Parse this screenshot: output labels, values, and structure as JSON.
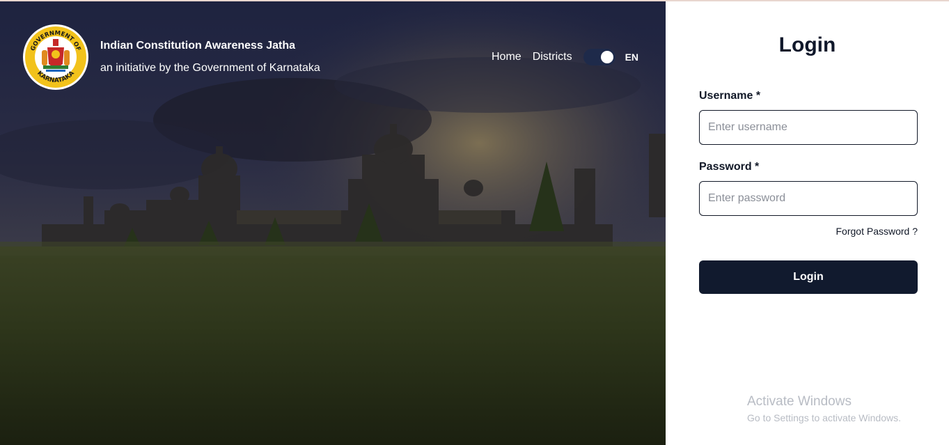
{
  "brand": {
    "title": "Indian Constitution Awareness Jatha",
    "subtitle": "an initiative by the Government of Karnataka",
    "emblem_icon": "karnataka-emblem-icon",
    "emblem_text_top": "GOVERNMENT OF",
    "emblem_text_bottom": "KARNATAKA"
  },
  "nav": {
    "home": "Home",
    "districts": "Districts",
    "language": "EN",
    "toggle_on": true
  },
  "login": {
    "title": "Login",
    "username_label": "Username *",
    "username_placeholder": "Enter username",
    "password_label": "Password *",
    "password_placeholder": "Enter password",
    "forgot": "Forgot Password ?",
    "submit": "Login"
  },
  "watermark": {
    "title": "Activate Windows",
    "subtitle": "Go to Settings to activate Windows."
  },
  "colors": {
    "primary": "#111a2e",
    "emblem_gold": "#f2c21b",
    "emblem_red": "#c62828"
  }
}
